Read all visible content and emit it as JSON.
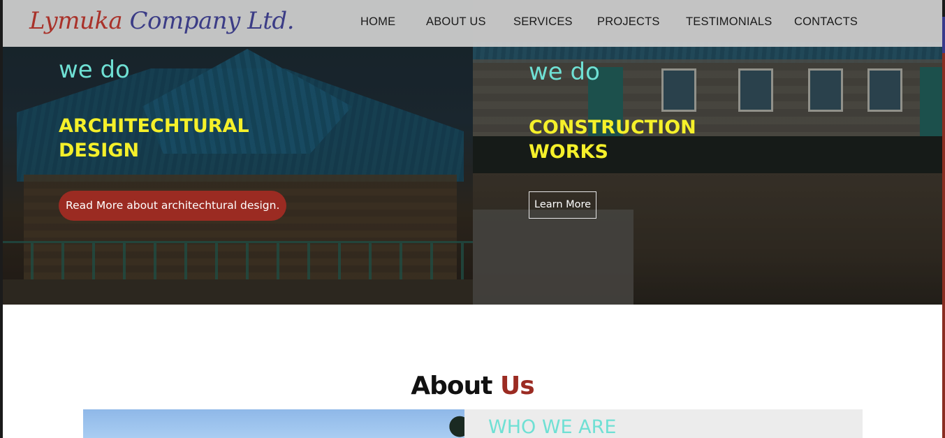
{
  "brand": {
    "logo_part1": "Lymuka",
    "logo_part2": " Company Ltd."
  },
  "nav": {
    "items": [
      "HOME",
      "ABOUT US",
      "SERVICES",
      "PROJECTS",
      "TESTIMONIALS",
      "CONTACTS"
    ]
  },
  "hero": {
    "slides": [
      {
        "kicker": "we do",
        "title_line1": "ARCHITECHTURAL",
        "title_line2": "DESIGN",
        "button": "Read More about architechtural design."
      },
      {
        "kicker": "we do",
        "title_line1": "CONSTRUCTION",
        "title_line2": "WORKS",
        "button": "Learn More"
      }
    ]
  },
  "about": {
    "heading_part1": "About ",
    "heading_part2": "Us",
    "card_title": "WHO WE ARE"
  },
  "colors": {
    "accent_red": "#9b2b22",
    "accent_teal": "#6fe0d4",
    "accent_yellow": "#f5f02a",
    "logo_blue": "#3b3c86"
  }
}
